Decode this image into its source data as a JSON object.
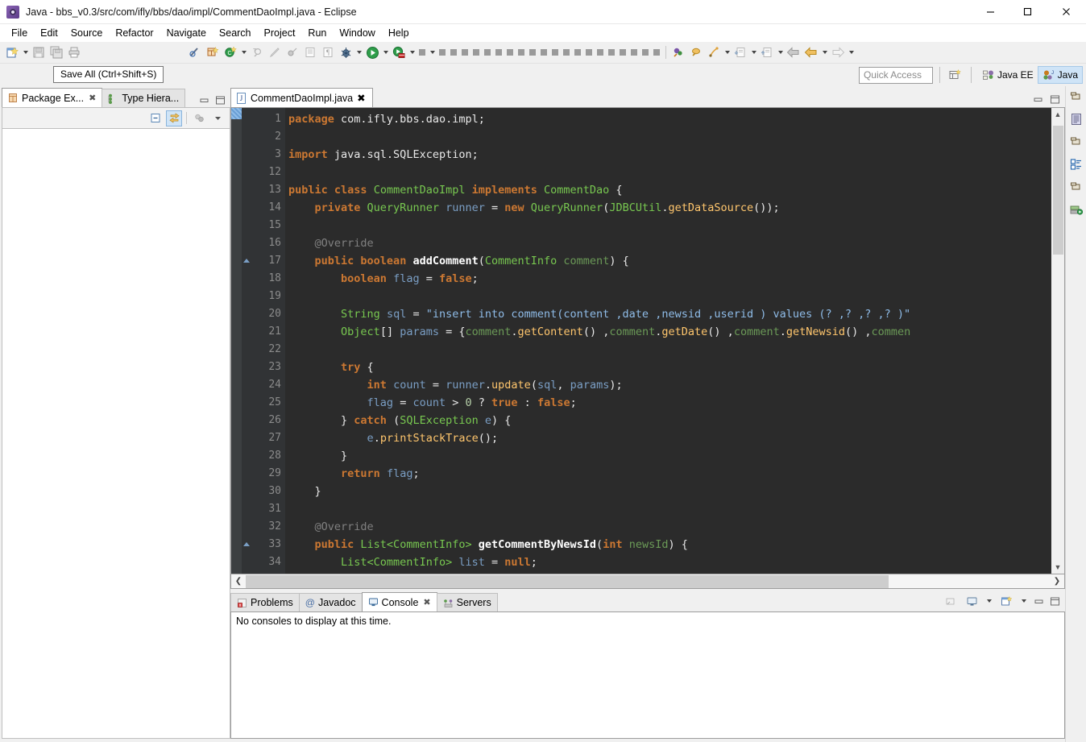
{
  "window": {
    "title": "Java - bbs_v0.3/src/com/ifly/bbs/dao/impl/CommentDaoImpl.java - Eclipse",
    "app_icon": "eclipse-icon",
    "minimize_label": "–",
    "maximize_label": "□",
    "close_label": "✕"
  },
  "menubar": {
    "items": [
      "File",
      "Edit",
      "Source",
      "Refactor",
      "Navigate",
      "Search",
      "Project",
      "Run",
      "Window",
      "Help"
    ]
  },
  "tooltip": {
    "text": "Save All (Ctrl+Shift+S)"
  },
  "quick_access": {
    "placeholder": "Quick Access",
    "value": "",
    "open_perspective_icon": "open-perspective-icon",
    "perspectives": [
      {
        "label": "Java EE",
        "active": false
      },
      {
        "label": "Java",
        "active": true
      }
    ]
  },
  "toolbar": {
    "gray_button_count": 24,
    "buttons": [
      "new-wizard-icon",
      "save-icon",
      "save-all-icon",
      "print-icon",
      "toggle-mark-occurrences-icon",
      "new-java-package-icon",
      "new-java-class-icon",
      "open-type-icon",
      "annotate-icon",
      "debug-last-icon",
      "open-task-icon",
      "pilcrow-icon",
      "debug-icon",
      "run-icon",
      "run-external-tools-icon",
      "stop-icon",
      "java-search-icon",
      "search-icon",
      "reference-search-icon",
      "next-annotation-icon",
      "previous-annotation-icon",
      "back-icon",
      "back-history-icon",
      "forward-icon"
    ]
  },
  "left_panel": {
    "tabs": [
      {
        "label": "Package Ex...",
        "icon": "package-explorer-icon",
        "active": true,
        "closable": true
      },
      {
        "label": "Type Hiera...",
        "icon": "type-hierarchy-icon",
        "active": false,
        "closable": false
      }
    ],
    "view_toolbar": [
      {
        "name": "collapse-all-icon",
        "selected": false
      },
      {
        "name": "link-with-editor-icon",
        "selected": true
      },
      {
        "name": "focus-on-active-task-icon",
        "selected": false
      },
      {
        "name": "view-menu-icon",
        "selected": false
      }
    ],
    "content": ""
  },
  "editor": {
    "tab": {
      "label": "CommentDaoImpl.java",
      "icon": "java-file-icon",
      "active": true,
      "closable": true
    },
    "minimize_icon": "minimize-icon",
    "maximize_icon": "maximize-icon",
    "lines": [
      {
        "num": "1",
        "fold": null,
        "annot": null,
        "tokens": [
          [
            "k",
            "package"
          ],
          [
            "pl",
            " com.ifly.bbs.dao.impl;"
          ]
        ]
      },
      {
        "num": "2",
        "fold": null,
        "annot": null,
        "tokens": []
      },
      {
        "num": "3",
        "fold": "plus",
        "annot": null,
        "tokens": [
          [
            "k",
            "import"
          ],
          [
            "pl",
            " java.sql.SQLException;"
          ]
        ]
      },
      {
        "num": "12",
        "fold": null,
        "annot": null,
        "tokens": []
      },
      {
        "num": "13",
        "fold": null,
        "annot": null,
        "tokens": [
          [
            "k",
            "public "
          ],
          [
            "k",
            "class "
          ],
          [
            "cls",
            "CommentDaoImpl "
          ],
          [
            "k",
            "implements "
          ],
          [
            "cls",
            "CommentDao "
          ],
          [
            "pl",
            "{"
          ]
        ]
      },
      {
        "num": "14",
        "fold": null,
        "annot": null,
        "tokens": [
          [
            "pl",
            "    "
          ],
          [
            "k",
            "private "
          ],
          [
            "cls",
            "QueryRunner "
          ],
          [
            "var",
            "runner "
          ],
          [
            "pl",
            "= "
          ],
          [
            "k",
            "new "
          ],
          [
            "cls",
            "QueryRunner"
          ],
          [
            "pl",
            "("
          ],
          [
            "cls",
            "JDBCUtil"
          ],
          [
            "pl",
            "."
          ],
          [
            "call",
            "getDataSource"
          ],
          [
            "pl",
            "());"
          ]
        ]
      },
      {
        "num": "15",
        "fold": null,
        "annot": null,
        "tokens": []
      },
      {
        "num": "16",
        "fold": "minus",
        "annot": null,
        "tokens": [
          [
            "pl",
            "    "
          ],
          [
            "ann",
            "@Override"
          ]
        ]
      },
      {
        "num": "17",
        "fold": null,
        "annot": "tri",
        "tokens": [
          [
            "pl",
            "    "
          ],
          [
            "k",
            "public "
          ],
          [
            "k",
            "boolean "
          ],
          [
            "mth",
            "addComment"
          ],
          [
            "pl",
            "("
          ],
          [
            "cls",
            "CommentInfo "
          ],
          [
            "prm",
            "comment"
          ],
          [
            "pl",
            ") {"
          ]
        ]
      },
      {
        "num": "18",
        "fold": null,
        "annot": null,
        "tokens": [
          [
            "pl",
            "        "
          ],
          [
            "k",
            "boolean "
          ],
          [
            "var",
            "flag "
          ],
          [
            "pl",
            "= "
          ],
          [
            "k",
            "false"
          ],
          [
            "pl",
            ";"
          ]
        ]
      },
      {
        "num": "19",
        "fold": null,
        "annot": null,
        "tokens": []
      },
      {
        "num": "20",
        "fold": null,
        "annot": null,
        "tokens": [
          [
            "pl",
            "        "
          ],
          [
            "cls",
            "String "
          ],
          [
            "var",
            "sql "
          ],
          [
            "pl",
            "= "
          ],
          [
            "str",
            "\"insert into comment(content ,date ,newsid ,userid ) values (? ,? ,? ,? )\""
          ]
        ]
      },
      {
        "num": "21",
        "fold": null,
        "annot": null,
        "tokens": [
          [
            "pl",
            "        "
          ],
          [
            "cls",
            "Object"
          ],
          [
            "pl",
            "[] "
          ],
          [
            "var",
            "params "
          ],
          [
            "pl",
            "= {"
          ],
          [
            "prm",
            "comment"
          ],
          [
            "pl",
            "."
          ],
          [
            "call",
            "getContent"
          ],
          [
            "pl",
            "() ,"
          ],
          [
            "prm",
            "comment"
          ],
          [
            "pl",
            "."
          ],
          [
            "call",
            "getDate"
          ],
          [
            "pl",
            "() ,"
          ],
          [
            "prm",
            "comment"
          ],
          [
            "pl",
            "."
          ],
          [
            "call",
            "getNewsid"
          ],
          [
            "pl",
            "() ,"
          ],
          [
            "prm",
            "commen"
          ]
        ]
      },
      {
        "num": "22",
        "fold": null,
        "annot": null,
        "tokens": []
      },
      {
        "num": "23",
        "fold": null,
        "annot": null,
        "tokens": [
          [
            "pl",
            "        "
          ],
          [
            "k",
            "try "
          ],
          [
            "pl",
            "{"
          ]
        ]
      },
      {
        "num": "24",
        "fold": null,
        "annot": null,
        "tokens": [
          [
            "pl",
            "            "
          ],
          [
            "k",
            "int "
          ],
          [
            "var",
            "count "
          ],
          [
            "pl",
            "= "
          ],
          [
            "var",
            "runner"
          ],
          [
            "pl",
            "."
          ],
          [
            "call",
            "update"
          ],
          [
            "pl",
            "("
          ],
          [
            "var",
            "sql"
          ],
          [
            "pl",
            ", "
          ],
          [
            "var",
            "params"
          ],
          [
            "pl",
            ");"
          ]
        ]
      },
      {
        "num": "25",
        "fold": null,
        "annot": null,
        "tokens": [
          [
            "pl",
            "            "
          ],
          [
            "var",
            "flag "
          ],
          [
            "pl",
            "= "
          ],
          [
            "var",
            "count "
          ],
          [
            "pl",
            "> "
          ],
          [
            "num",
            "0 "
          ],
          [
            "pl",
            "? "
          ],
          [
            "k",
            "true "
          ],
          [
            "pl",
            ": "
          ],
          [
            "k",
            "false"
          ],
          [
            "pl",
            ";"
          ]
        ]
      },
      {
        "num": "26",
        "fold": null,
        "annot": null,
        "tokens": [
          [
            "pl",
            "        } "
          ],
          [
            "k",
            "catch "
          ],
          [
            "pl",
            "("
          ],
          [
            "cls",
            "SQLException "
          ],
          [
            "var",
            "e"
          ],
          [
            "pl",
            ") {"
          ]
        ]
      },
      {
        "num": "27",
        "fold": null,
        "annot": null,
        "tokens": [
          [
            "pl",
            "            "
          ],
          [
            "var",
            "e"
          ],
          [
            "pl",
            "."
          ],
          [
            "call",
            "printStackTrace"
          ],
          [
            "pl",
            "();"
          ]
        ]
      },
      {
        "num": "28",
        "fold": null,
        "annot": null,
        "tokens": [
          [
            "pl",
            "        }"
          ]
        ]
      },
      {
        "num": "29",
        "fold": null,
        "annot": null,
        "tokens": [
          [
            "pl",
            "        "
          ],
          [
            "k",
            "return "
          ],
          [
            "var",
            "flag"
          ],
          [
            "pl",
            ";"
          ]
        ]
      },
      {
        "num": "30",
        "fold": null,
        "annot": null,
        "tokens": [
          [
            "pl",
            "    }"
          ]
        ]
      },
      {
        "num": "31",
        "fold": null,
        "annot": null,
        "tokens": []
      },
      {
        "num": "32",
        "fold": "minus",
        "annot": null,
        "tokens": [
          [
            "pl",
            "    "
          ],
          [
            "ann",
            "@Override"
          ]
        ]
      },
      {
        "num": "33",
        "fold": null,
        "annot": "tri",
        "tokens": [
          [
            "pl",
            "    "
          ],
          [
            "k",
            "public "
          ],
          [
            "cls",
            "List<CommentInfo> "
          ],
          [
            "mth",
            "getCommentByNewsId"
          ],
          [
            "pl",
            "("
          ],
          [
            "k",
            "int "
          ],
          [
            "prm",
            "newsId"
          ],
          [
            "pl",
            ") {"
          ]
        ]
      },
      {
        "num": "34",
        "fold": null,
        "annot": null,
        "tokens": [
          [
            "pl",
            "        "
          ],
          [
            "cls",
            "List<CommentInfo> "
          ],
          [
            "var",
            "list "
          ],
          [
            "pl",
            "= "
          ],
          [
            "k",
            "null"
          ],
          [
            "pl",
            ";"
          ]
        ]
      }
    ],
    "colors": {
      "background": "#2b2b2b",
      "gutter_background": "#313335",
      "keyword": "#cc7832",
      "class": "#78c850",
      "string": "#8fbce8",
      "method_call": "#ffc66d",
      "local_var": "#7a9ec4",
      "annotation": "#808080",
      "plain": "#e8e8e8"
    }
  },
  "console_panel": {
    "tabs": [
      {
        "label": "Problems",
        "icon": "problems-icon",
        "active": false,
        "closable": false
      },
      {
        "label": "Javadoc",
        "icon": "javadoc-icon",
        "active": false,
        "closable": false
      },
      {
        "label": "Console",
        "icon": "console-icon",
        "active": true,
        "closable": true
      },
      {
        "label": "Servers",
        "icon": "servers-icon",
        "active": false,
        "closable": false
      }
    ],
    "toolbar": [
      "clear-console-icon",
      "display-selected-console-icon",
      "open-console-icon",
      "minimize-icon",
      "maximize-icon"
    ],
    "message": "No consoles to display at this time."
  },
  "right_sidebar": {
    "icons": [
      "restore-view-icon",
      "outline-view-icon",
      "restore-view-icon",
      "properties-view-icon",
      "restore-view-icon",
      "servers-view-icon"
    ]
  }
}
